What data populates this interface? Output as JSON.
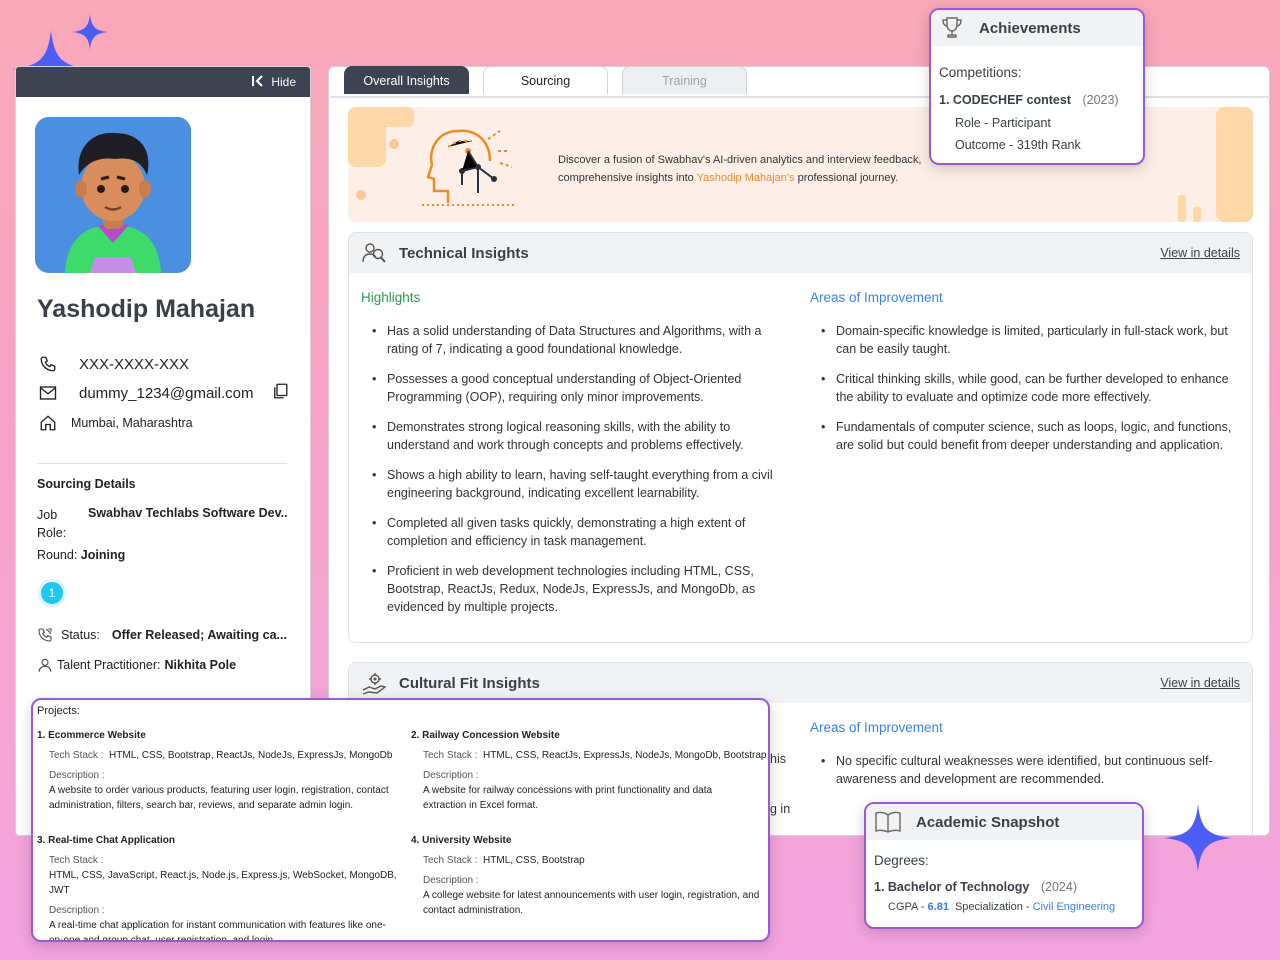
{
  "sidebar": {
    "hide_label": "Hide",
    "name": "Yashodip Mahajan",
    "phone": "XXX-XXXX-XXX",
    "email": "dummy_1234@gmail.com",
    "location": "Mumbai, Maharashtra",
    "sourcing_title": "Sourcing Details",
    "job_label": "Job Role:",
    "job_value": "Swabhav Techlabs Software Dev...",
    "round_label": "Round:",
    "round_value": "Joining",
    "round_step": "1",
    "status_label": "Status:",
    "status_value": "Offer Released; Awaiting ca...",
    "practitioner_label": "Talent Practitioner:",
    "practitioner_value": "Nikhita Pole"
  },
  "tabs": [
    {
      "label": "Overall Insights",
      "state": "active"
    },
    {
      "label": "Sourcing",
      "state": "normal"
    },
    {
      "label": "Training",
      "state": "disabled"
    }
  ],
  "banner": {
    "text_1": "Discover a fusion of Swabhav's AI-driven analytics and interview feedback,",
    "text_2a": "comprehensive insights into ",
    "text_2b": "Yashodip Mahajan's",
    "text_2c": " professional journey."
  },
  "technical": {
    "title": "Technical Insights",
    "link": "View in details",
    "highlights_title": "Highlights",
    "improve_title": "Areas of Improvement",
    "highlights": [
      "Has a solid understanding of Data Structures and Algorithms, with a rating of 7, indicating a good foundational knowledge.",
      "Possesses a good conceptual understanding of Object-Oriented Programming (OOP), requiring only minor improvements.",
      "Demonstrates strong logical reasoning skills, with the ability to understand and work through concepts and problems effectively.",
      "Shows a high ability to learn, having self-taught everything from a civil engineering background, indicating excellent learnability.",
      "Completed all given tasks quickly, demonstrating a high extent of completion and efficiency in task management.",
      "Proficient in web development technologies including HTML, CSS, Bootstrap, ReactJs, Redux, NodeJs, ExpressJs, and MongoDb, as evidenced by multiple projects."
    ],
    "improvements": [
      "Domain-specific knowledge is limited, particularly in full-stack work, but can be easily taught.",
      "Critical thinking skills, while good, can be further developed to enhance the ability to evaluate and optimize code more effectively.",
      "Fundamentals of computer science, such as loops, logic, and functions, are solid but could benefit from deeper understanding and application."
    ]
  },
  "cultural": {
    "title": "Cultural Fit Insights",
    "link": "View in details",
    "improve_title": "Areas of Improvement",
    "improvements": [
      "No specific cultural weaknesses were identified, but continuous self-awareness and development are recommended."
    ],
    "partial_1": "his",
    "partial_2": "g in"
  },
  "achievements": {
    "title": "Achievements",
    "section": "Competitions:",
    "item_title": "1. CODECHEF contest",
    "item_year": "(2023)",
    "role_label": "Role - ",
    "role_value": "Participant",
    "outcome_label": "Outcome - ",
    "outcome_value": "319th Rank"
  },
  "academic": {
    "title": "Academic Snapshot",
    "section": "Degrees:",
    "item_title": "1. Bachelor of Technology",
    "item_year": "(2024)",
    "cgpa_label": "CGPA - ",
    "cgpa_value": "6.81",
    "spec_label": "Specialization - ",
    "spec_value": "Civil Engineering"
  },
  "projects": {
    "title": "Projects:",
    "tech_label": "Tech Stack :",
    "desc_label": "Description :",
    "items": [
      {
        "title": "1. Ecommerce Website",
        "stack": "HTML, CSS, Bootstrap, ReactJs, NodeJs, ExpressJs, MongoDb",
        "desc": "A website to order various products, featuring user login, registration, contact administration, filters, search bar, reviews, and separate admin login."
      },
      {
        "title": "2. Railway Concession Website",
        "stack": "HTML, CSS, ReactJs, ExpressJs, NodeJs, MongoDb, Bootstrap",
        "desc": "A website for railway concessions with print functionality and data extraction in Excel format."
      },
      {
        "title": "3. Real-time Chat Application",
        "stack": "HTML, CSS, JavaScript, React.js, Node.js, Express.js, WebSocket, MongoDB, JWT",
        "desc": "A real-time chat application for instant communication with features like one-on-one and group chat, user registration, and login."
      },
      {
        "title": "4. University Website",
        "stack": "HTML, CSS, Bootstrap",
        "desc": "A college website for latest announcements with user login, registration, and contact administration."
      }
    ]
  },
  "colors": {
    "accent_dark": "#3d4350",
    "highlight_green": "#2e9a4e",
    "improve_blue": "#3b82e0",
    "popup_border": "#9b59d6",
    "banner_orange": "#f08a24"
  }
}
